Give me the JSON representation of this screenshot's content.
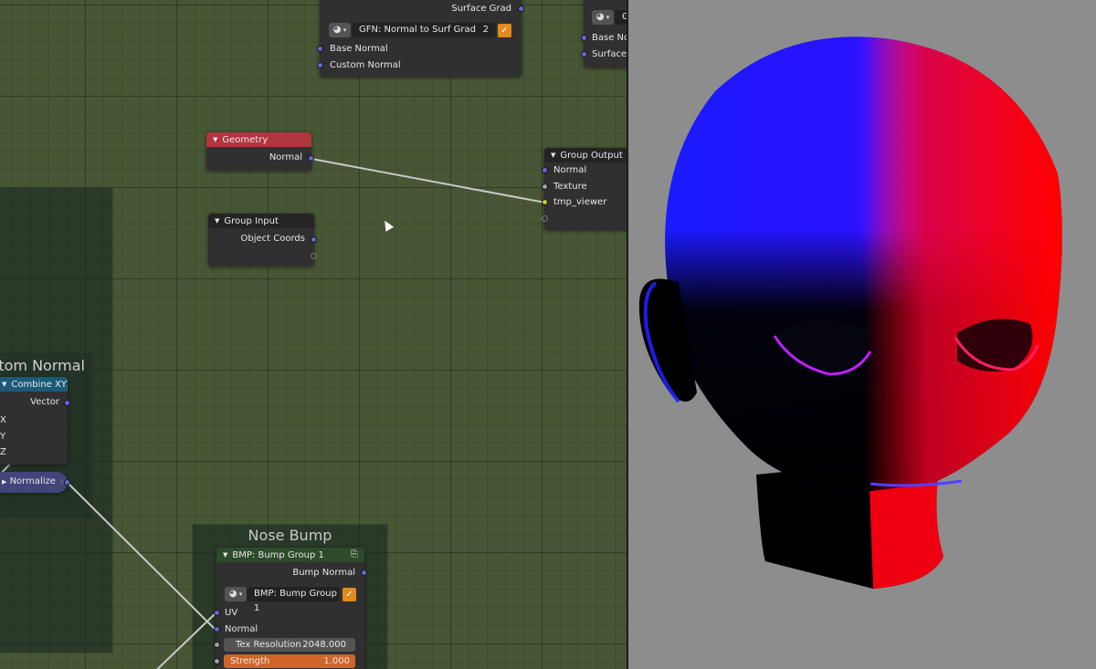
{
  "colors": {
    "editor_bg": "#475634",
    "node_bg": "#303030",
    "geometry_header": "#b2343f",
    "combine_header": "#1c5a7a",
    "normalize_bg": "#43447a",
    "socket_vector": "#6767d3",
    "socket_float": "#a1a1a1",
    "socket_color": "#c7c729",
    "active_slider": "#d0652a"
  },
  "nodes": {
    "surfgrad": {
      "out_surface_grad": "Surface Grad",
      "group_name": "GFN: Normal to Surf Grad",
      "user_count": "2",
      "in_base_normal": "Base Normal",
      "in_custom_normal": "Custom Normal"
    },
    "partial": {
      "group_name": "G",
      "in_base": "Base No",
      "in_surface": "Surface"
    },
    "geometry": {
      "title": "Geometry",
      "out_normal": "Normal"
    },
    "group_output": {
      "title": "Group Output",
      "in_normal": "Normal",
      "in_texture": "Texture",
      "in_tmp_viewer": "tmp_viewer"
    },
    "group_input": {
      "title": "Group Input",
      "out_object_coords": "Object Coords"
    },
    "combine_xyz": {
      "title": "Combine XYZ",
      "out_vector": "Vector",
      "in_x": "X",
      "in_y": "Y",
      "in_z": "Z"
    },
    "normalize": {
      "title": "Normalize"
    },
    "bump": {
      "title": "BMP: Bump Group 1",
      "out_bump_normal": "Bump Normal",
      "group_name": "BMP: Bump Group 1",
      "in_uv": "UV",
      "in_normal": "Normal",
      "tex_res_label": "Tex Resolution",
      "tex_res_value": "2048.000",
      "strength_label": "Strength",
      "strength_value": "1.000"
    }
  },
  "frames": {
    "custom_normal": "stom Normal",
    "nose_bump": "Nose Bump"
  }
}
